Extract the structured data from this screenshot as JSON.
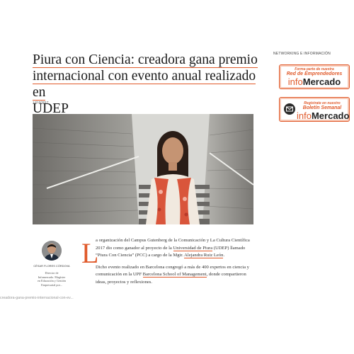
{
  "article": {
    "title_line1": "Piura con Ciencia: creadora gana premio",
    "title_line2": "internacional con evento anual realizado en",
    "title_line3": "UDEP",
    "date": "14/10/2017",
    "body": {
      "p1_a": "a organización del Campus Gutenberg de la Comunicación y La Cultura Científica 2017 dio como ganador al proyecto de la ",
      "p1_link1": "Universidad de Piura",
      "p1_b": " (UDEP) llamado “Piura Con Ciencia” (PCC) a cargo de la Mgtr. ",
      "p1_link2": "Alejandra Ruiz León",
      "p1_c": ".",
      "p2_a": "Dicho evento realizado en Barcelona congregó a más de 400 expertos en ciencia y comunicación en la UPF ",
      "p2_link": "Barcelona School of Management",
      "p2_b": ", donde compartieron ideas, proyectos y reflexiones."
    },
    "dropcap": "L"
  },
  "author": {
    "name": "CÉSAR FLORES CÓRDOVA",
    "bio": "Director de Infomercado. Magíster en Educación y Gestión Empresarial por..."
  },
  "sidebar": {
    "heading": "NETWORKING E INFORMACIÓN",
    "promo1": {
      "small": "Forma parte de nuestra",
      "medium": "Red de Emprendedores",
      "brand_a": "info",
      "brand_b": "Mercado"
    },
    "promo2": {
      "small": "Regístrate en nuestro",
      "medium": "Boletín Semanal",
      "brand_a": "info",
      "brand_b": "Mercado"
    }
  },
  "status_bar": {
    "url": "creadora-gana-premio-internacional-con-ev..."
  },
  "colors": {
    "accent": "#e05a2b"
  }
}
